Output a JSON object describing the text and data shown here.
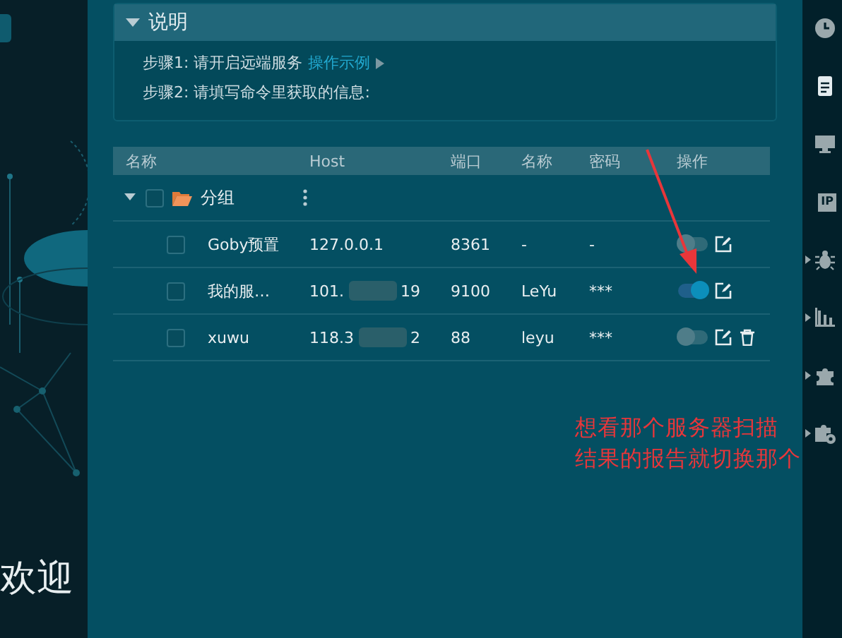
{
  "background_page": {
    "kind": "picture",
    "welcome_text": "欢迎"
  },
  "instructions": {
    "title": "说明",
    "expanded": true,
    "steps": [
      {
        "text": "步骤1: 请开启远端服务",
        "link": "操作示例"
      },
      {
        "text": "步骤2: 请填写命令里获取的信息:"
      }
    ]
  },
  "table": {
    "columns": [
      "名称",
      "Host",
      "端口",
      "名称",
      "密码",
      "操作"
    ],
    "groups": [
      {
        "name": "分组",
        "expanded": true,
        "checked": false,
        "rows": [
          {
            "name": "Goby预置",
            "host_parts": [
              "127.0.0.1"
            ],
            "port": "8361",
            "user": "-",
            "password": "-",
            "checked": false,
            "on": false,
            "deletable": false
          },
          {
            "name": "我的服…",
            "host_parts": [
              "101.",
              "19"
            ],
            "port": "9100",
            "user": "LeYu",
            "password": "***",
            "checked": false,
            "on": true,
            "deletable": false
          },
          {
            "name": "xuwu",
            "host_parts": [
              "118.3",
              "2"
            ],
            "port": "88",
            "user": "leyu",
            "password": "***",
            "checked": false,
            "on": false,
            "deletable": true
          }
        ]
      }
    ]
  },
  "sidebar": {
    "items": [
      {
        "kind": "clock",
        "selected": false,
        "has_submenu": false
      },
      {
        "kind": "document",
        "selected": true,
        "has_submenu": false
      },
      {
        "kind": "monitor",
        "selected": false,
        "has_submenu": false
      },
      {
        "kind": "ip",
        "label": "IP",
        "selected": false,
        "has_submenu": false
      },
      {
        "kind": "bug",
        "selected": false,
        "has_submenu": true
      },
      {
        "kind": "chart",
        "selected": false,
        "has_submenu": true
      },
      {
        "kind": "puzzle",
        "selected": false,
        "has_submenu": true
      },
      {
        "kind": "puzzle-gear",
        "selected": false,
        "has_submenu": true
      }
    ]
  },
  "annotation": {
    "lines": [
      "想看那个服务器扫描",
      "结果的报告就切换那个"
    ]
  }
}
